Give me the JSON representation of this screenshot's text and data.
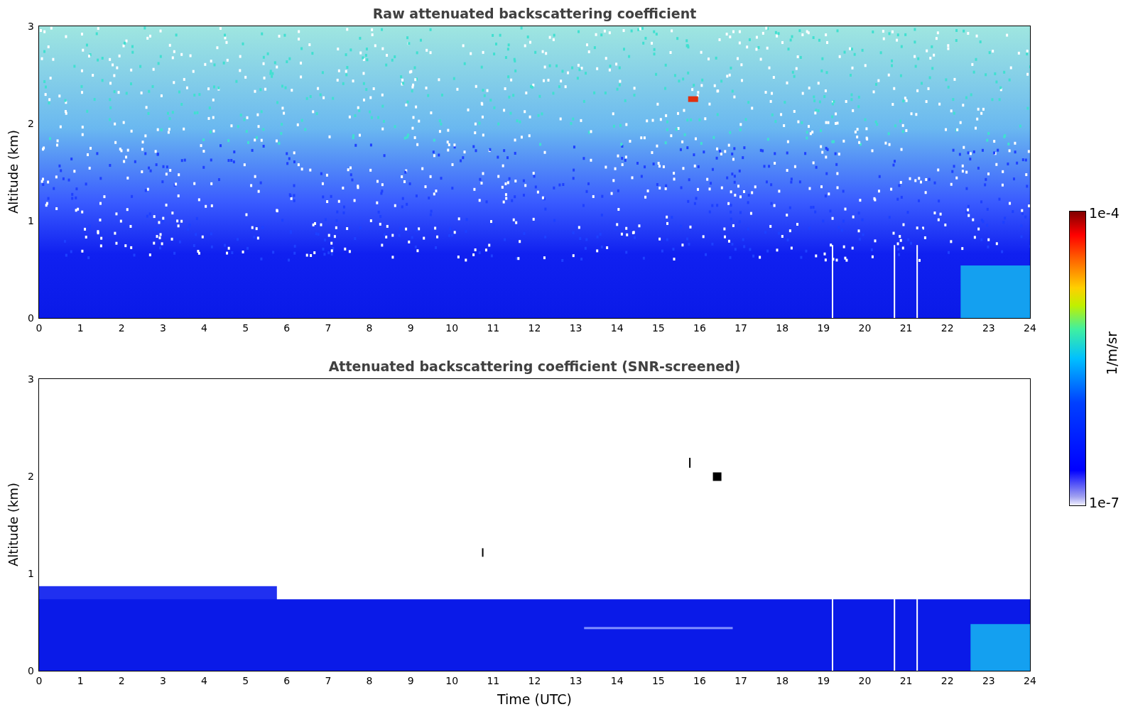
{
  "panels": [
    {
      "kind": "raw",
      "title": "Raw attenuated backscattering coefficient",
      "ylabel": "Altitude (km)",
      "yticks": [
        "3",
        "2",
        "1",
        "0"
      ],
      "xticks": [
        "0",
        "1",
        "2",
        "3",
        "4",
        "5",
        "6",
        "7",
        "8",
        "9",
        "10",
        "11",
        "12",
        "13",
        "14",
        "15",
        "16",
        "17",
        "18",
        "19",
        "20",
        "21",
        "22",
        "23",
        "24"
      ]
    },
    {
      "kind": "screened",
      "title": "Attenuated backscattering coefficient (SNR-screened)",
      "ylabel": "Altitude (km)",
      "yticks": [
        "3",
        "2",
        "1",
        "0"
      ],
      "xticks": [
        "0",
        "1",
        "2",
        "3",
        "4",
        "5",
        "6",
        "7",
        "8",
        "9",
        "10",
        "11",
        "12",
        "13",
        "14",
        "15",
        "16",
        "17",
        "18",
        "19",
        "20",
        "21",
        "22",
        "23",
        "24"
      ],
      "xlabel": "Time (UTC)"
    }
  ],
  "colorbar": {
    "max_label": "1e-4",
    "min_label": "1e-7",
    "unit": "1/m/sr"
  }
}
